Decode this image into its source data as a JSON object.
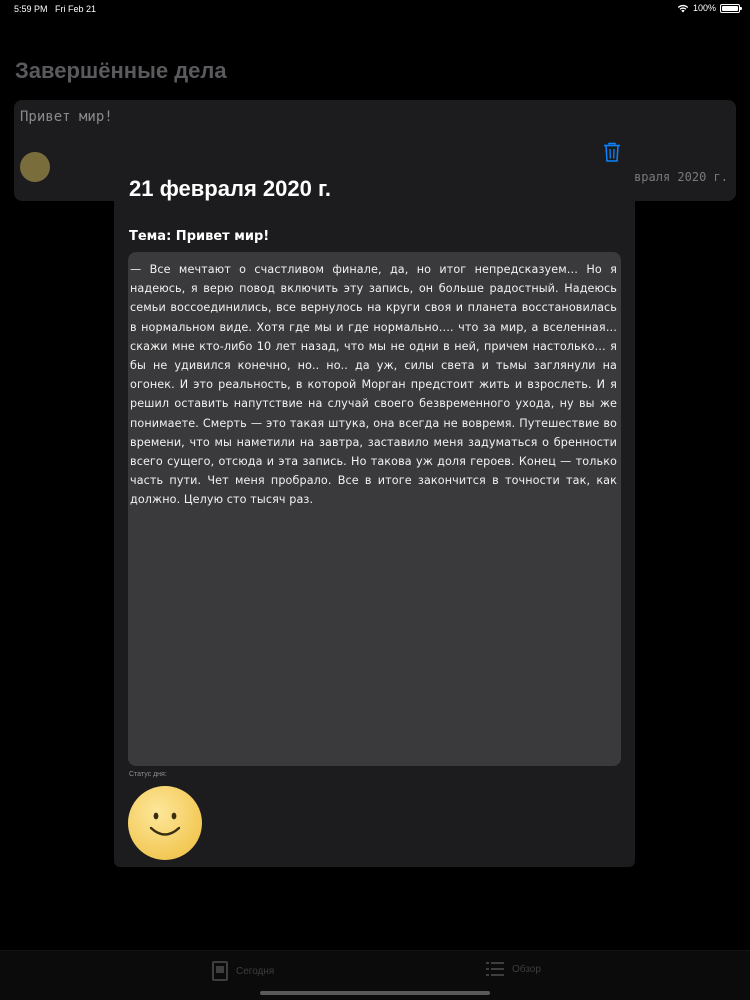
{
  "status_bar": {
    "time": "5:59 PM",
    "date": "Fri Feb 21",
    "battery": "100%"
  },
  "background": {
    "title": "Завершённые дела",
    "card": {
      "title": "Привет мир!",
      "date": "февраля 2020 г."
    }
  },
  "sheet": {
    "date_title": "21 февраля 2020 г.",
    "topic": "Тема: Привет мир!",
    "entry_text": "— Все мечтают о счастливом финале, да, но итог непредсказуем… Но я надеюсь, я верю повод включить эту запись, он больше радостный. Надеюсь семьи воссоединились, все вернулось на круги своя и планета восстановилась в нормальном виде. Хотя где мы и где нормально…. что за мир, а вселенная… скажи мне кто-либо 10 лет назад, что мы не одни в ней, причем настолько… я бы не удивился конечно, но.. но.. да уж, силы света и тьмы заглянули на огонек. И это реальность, в которой Морган предстоит жить и взрослеть. И я решил оставить напутствие на случай своего безвременного ухода, ну вы же понимаете. Смерть — это такая штука, она всегда не вовремя. Путешествие во времени, что мы наметили на завтра, заставило меня задуматься о бренности всего сущего, отсюда и эта запись. Но такова уж доля героев. Конец — только часть пути. Чет меня пробрало. Все в итоге закончится в точности так, как должно. Целую сто тысяч раз.",
    "status_caption": "Статус дня:",
    "mood": "smile"
  },
  "tab_bar": {
    "tabs": [
      {
        "label": "Сегодня",
        "icon": "calendar-icon"
      },
      {
        "label": "Обзор",
        "icon": "list-icon"
      }
    ]
  },
  "colors": {
    "accent": "#0a84ff",
    "sheet": "#1c1c1e",
    "entry_box": "#3a3a3c",
    "smile": "#f3c957"
  }
}
